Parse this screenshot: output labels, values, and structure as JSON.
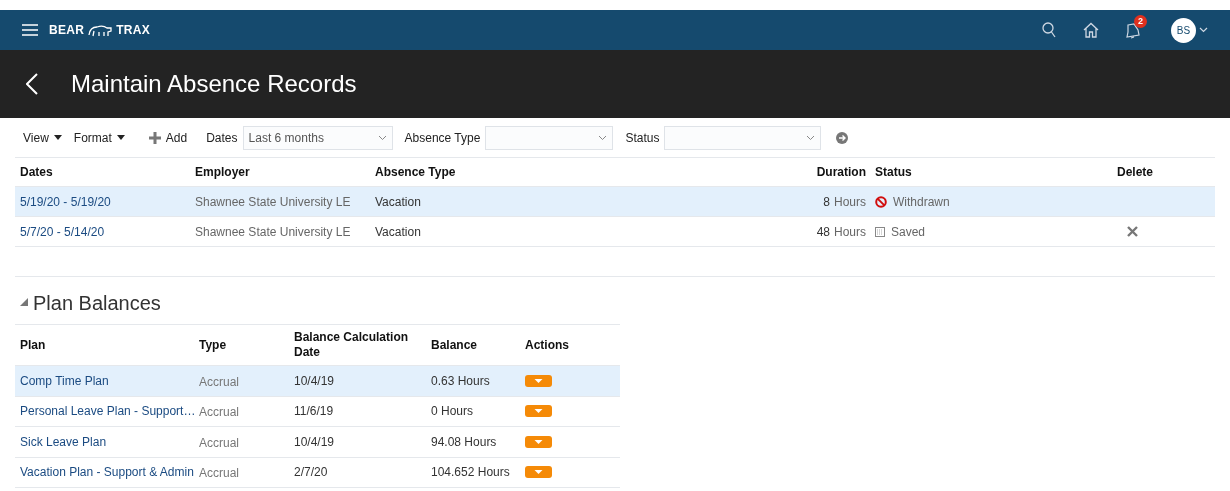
{
  "header": {
    "brand_left": "BEAR",
    "brand_right": "TRAX",
    "notifications": "2",
    "avatar": "BS"
  },
  "page": {
    "title": "Maintain Absence Records"
  },
  "toolbar": {
    "view": "View",
    "format": "Format",
    "add": "Add",
    "filters": [
      {
        "label": "Dates",
        "value": "Last 6 months"
      },
      {
        "label": "Absence Type"
      },
      {
        "label": "Status"
      }
    ]
  },
  "absences": {
    "columns": [
      "Dates",
      "Employer",
      "Absence Type",
      "Duration",
      "Status",
      "Delete"
    ],
    "rows": [
      {
        "dates": "5/19/20 - 5/19/20",
        "employer": "Shawnee State University LE",
        "type": "Vacation",
        "amount": "8",
        "unit": "Hours",
        "status": "Withdrawn",
        "kind": "withdrawn",
        "deletable": false,
        "selected": true
      },
      {
        "dates": "5/7/20 - 5/14/20",
        "employer": "Shawnee State University LE",
        "type": "Vacation",
        "amount": "48",
        "unit": "Hours",
        "status": "Saved",
        "kind": "saved",
        "deletable": true,
        "selected": false
      }
    ]
  },
  "plan_balances": {
    "title": "Plan Balances",
    "expanded": true,
    "columns": [
      "Plan",
      "Type",
      "Balance Calculation Date",
      "Balance",
      "Actions"
    ],
    "rows": [
      {
        "plan": "Comp Time Plan",
        "type": "Accrual",
        "date": "10/4/19",
        "balance": "0.63 Hours",
        "selected": true
      },
      {
        "plan": "Personal Leave Plan - Support…",
        "type": "Accrual",
        "date": "11/6/19",
        "balance": "0 Hours",
        "selected": false
      },
      {
        "plan": "Sick Leave Plan",
        "type": "Accrual",
        "date": "10/4/19",
        "balance": "94.08 Hours",
        "selected": false
      },
      {
        "plan": "Vacation Plan - Support & Admin",
        "type": "Accrual",
        "date": "2/7/20",
        "balance": "104.652 Hours",
        "selected": false
      }
    ]
  }
}
